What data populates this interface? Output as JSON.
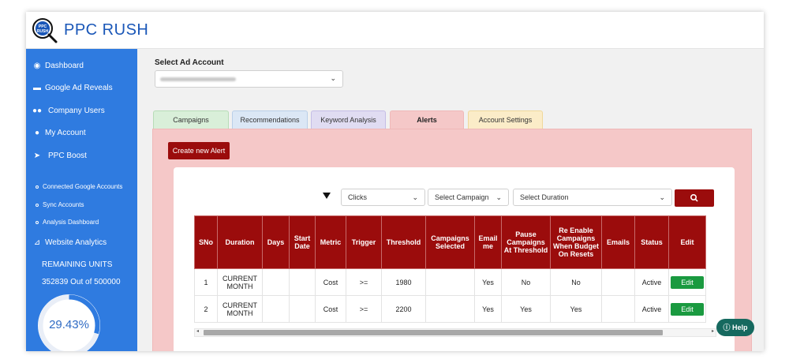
{
  "brand": {
    "name": "PPC RUSH",
    "logo_text": "PPC RUSH"
  },
  "sidebar": {
    "items": [
      {
        "label": "Dashboard",
        "icon": "palette-icon"
      },
      {
        "label": "Google Ad Reveals",
        "icon": "briefcase-icon"
      },
      {
        "label": "Company Users",
        "icon": "users-icon"
      },
      {
        "label": "My Account",
        "icon": "user-cog-icon"
      },
      {
        "label": "PPC Boost",
        "icon": "rocket-icon"
      }
    ],
    "sub_items": [
      {
        "label": "Connected Google Accounts"
      },
      {
        "label": "Sync Accounts"
      },
      {
        "label": "Analysis Dashboard"
      }
    ],
    "analytics": {
      "label": "Website Analytics",
      "icon": "chart-line-icon"
    },
    "units": {
      "title": "REMAINING UNITS",
      "value": "352839 Out of 500000",
      "percent_text": "29.43%",
      "percent": 29.43
    }
  },
  "account": {
    "label": "Select Ad Account"
  },
  "tabs": [
    {
      "label": "Campaigns",
      "active": false,
      "color": "#d9efd9"
    },
    {
      "label": "Recommendations",
      "active": false,
      "color": "#dbe7f5"
    },
    {
      "label": "Keyword Analysis",
      "active": false,
      "color": "#e0dcf2"
    },
    {
      "label": "Alerts",
      "active": true,
      "color": "#f5c8c8"
    },
    {
      "label": "Account Settings",
      "active": false,
      "color": "#fbecc8"
    }
  ],
  "alerts": {
    "create_button": "Create new Alert",
    "filters": {
      "metric": "Clicks",
      "campaign": "Select Campaign",
      "duration": "Select Duration"
    },
    "table": {
      "headers": [
        "SNo",
        "Duration",
        "Days",
        "Start Date",
        "Metric",
        "Trigger",
        "Threshold",
        "Campaigns Selected",
        "Email me",
        "Pause Campaigns At Threshold",
        "Re Enable Campaigns When Budget On Resets",
        "Emails",
        "Status",
        "Edit"
      ],
      "rows": [
        {
          "sno": "1",
          "duration": "CURRENT MONTH",
          "days": "",
          "start_date": "",
          "metric": "Cost",
          "trigger": ">=",
          "threshold": "1980",
          "campaigns_selected": "",
          "email_me": "Yes",
          "pause": "No",
          "reenable": "No",
          "emails": "",
          "status": "Active",
          "edit": "Edit"
        },
        {
          "sno": "2",
          "duration": "CURRENT MONTH",
          "days": "",
          "start_date": "",
          "metric": "Cost",
          "trigger": ">=",
          "threshold": "2200",
          "campaigns_selected": "",
          "email_me": "Yes",
          "pause": "Yes",
          "reenable": "Yes",
          "emails": "",
          "status": "Active",
          "edit": "Edit"
        }
      ]
    }
  },
  "help": {
    "label": "Help"
  },
  "colors": {
    "sidebar": "#2f7be0",
    "accent": "#9b0c0c",
    "edit": "#1a9a40",
    "brand": "#1a57b8",
    "help": "#16695f"
  }
}
